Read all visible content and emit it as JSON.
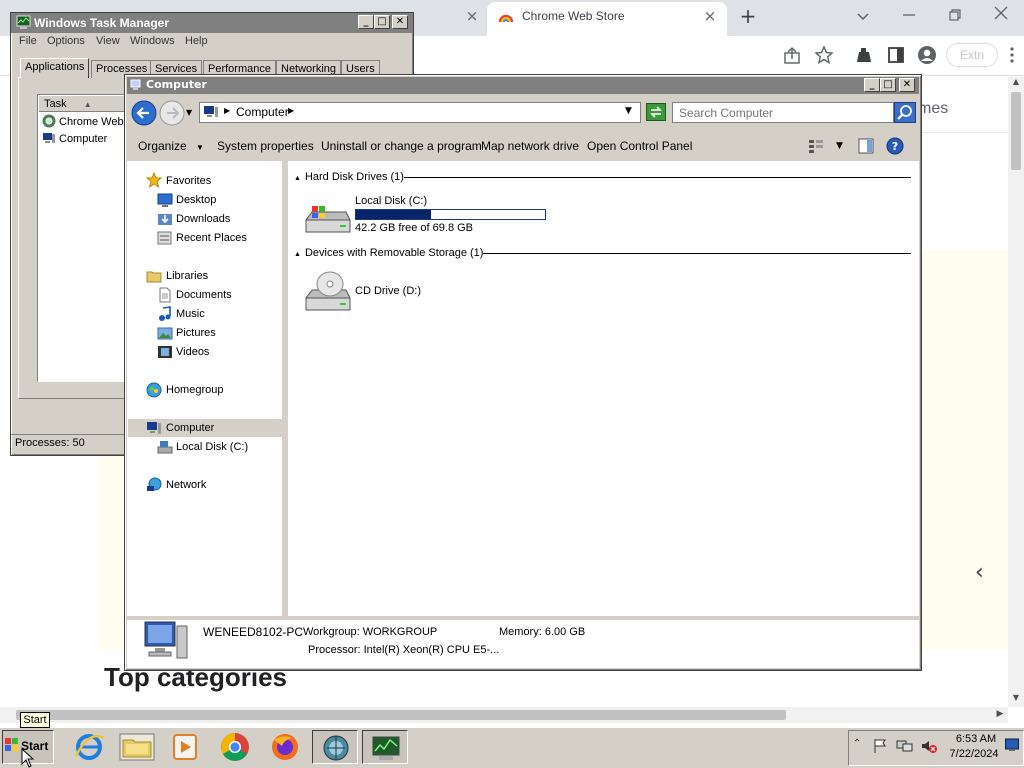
{
  "chrome": {
    "active_tab_title": "Chrome Web Store",
    "tab_close_glyph": "×",
    "new_tab_glyph": "+",
    "action_button_label": "Extn",
    "page": {
      "header_fragment": "mes",
      "section_title": "Top categories",
      "carousel_prev_glyph": "‹"
    }
  },
  "task_manager": {
    "title": "Windows Task Manager",
    "menu": [
      "File",
      "Options",
      "View",
      "Windows",
      "Help"
    ],
    "tabs": [
      "Applications",
      "Processes",
      "Services",
      "Performance",
      "Networking",
      "Users"
    ],
    "active_tab": "Applications",
    "list_header": "Task",
    "tasks": [
      "Chrome Web",
      "Computer"
    ],
    "status_processes": "Processes: 50"
  },
  "explorer": {
    "title": "Computer",
    "address_path": "Computer",
    "search_placeholder": "Search Computer",
    "commands": [
      "Organize",
      "System properties",
      "Uninstall or change a program",
      "Map network drive",
      "Open Control Panel"
    ],
    "nav": {
      "favorites": "Favorites",
      "desktop": "Desktop",
      "downloads": "Downloads",
      "recent": "Recent Places",
      "libraries": "Libraries",
      "documents": "Documents",
      "music": "Music",
      "pictures": "Pictures",
      "videos": "Videos",
      "homegroup": "Homegroup",
      "computer": "Computer",
      "local_disk": "Local Disk (C:)",
      "network": "Network"
    },
    "groups": {
      "hdd": "Hard Disk Drives (1)",
      "removable": "Devices with Removable Storage (1)"
    },
    "drives": {
      "c_name": "Local Disk (C:)",
      "c_free_text": "42.2 GB free of 69.8 GB",
      "c_used_fraction": 0.395,
      "d_name": "CD Drive (D:)"
    },
    "details": {
      "pc_name": "WENEED8102-PC",
      "workgroup": "Workgroup: WORKGROUP",
      "memory": "Memory: 6.00 GB",
      "processor": "Processor: Intel(R) Xeon(R) CPU E5-..."
    }
  },
  "taskbar": {
    "start_label": "Start",
    "start_tooltip": "Start",
    "tray_time": "6:53 AM",
    "tray_date": "7/22/2024"
  },
  "icons": {
    "start": "windows-logo-icon",
    "ie": "internet-explorer-icon",
    "explorer": "folder-icon",
    "media": "media-player-icon",
    "chrome": "chrome-icon",
    "firefox": "firefox-icon",
    "network": "network-globe-icon",
    "task_manager": "task-manager-icon"
  },
  "colors": {
    "classic_face": "#d4d0c8",
    "drive_bar": "#0a246a",
    "chrome_tabstrip": "#dee1e6"
  }
}
